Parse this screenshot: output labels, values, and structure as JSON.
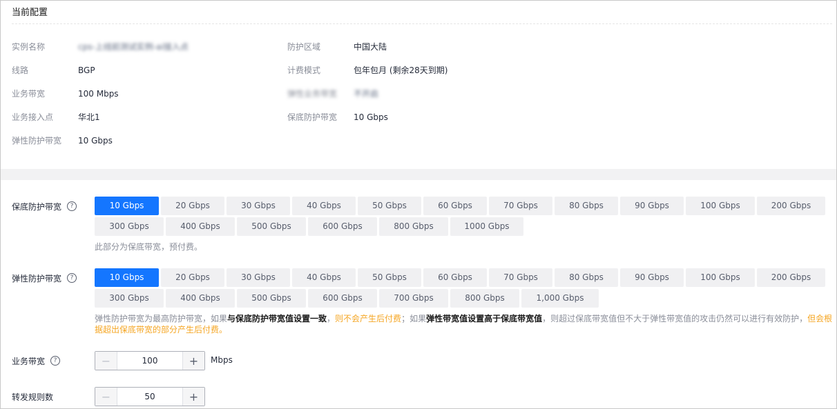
{
  "config": {
    "title": "当前配置",
    "items": [
      {
        "label": "实例名称",
        "value": "cps-上线前测试实例-ai接入点"
      },
      {
        "label": "线路",
        "value": "BGP"
      },
      {
        "label": "业务带宽",
        "value": "100 Mbps"
      },
      {
        "label": "业务接入点",
        "value": "华北1"
      },
      {
        "label": "弹性防护带宽",
        "value": "10 Gbps"
      },
      {
        "label": "防护区域",
        "value": "中国大陆"
      },
      {
        "label": "计费模式",
        "value": "包年包月 (剩余28天到期)"
      },
      {
        "label": "弹性业务带宽",
        "value": "不开启"
      },
      {
        "label": "保底防护带宽",
        "value": "10 Gbps"
      }
    ]
  },
  "base_protection": {
    "label": "保底防护带宽",
    "selected": "10 Gbps",
    "options_row1": [
      "10 Gbps",
      "20 Gbps",
      "30 Gbps",
      "40 Gbps",
      "50 Gbps",
      "60 Gbps",
      "70 Gbps",
      "80 Gbps",
      "90 Gbps",
      "100 Gbps",
      "200 Gbps"
    ],
    "options_row2": [
      "300 Gbps",
      "400 Gbps",
      "500 Gbps",
      "600 Gbps",
      "800 Gbps",
      "1000 Gbps"
    ],
    "hint": "此部分为保底带宽，预付费。"
  },
  "elastic_protection": {
    "label": "弹性防护带宽",
    "selected": "10 Gbps",
    "options_row1": [
      "10 Gbps",
      "20 Gbps",
      "30 Gbps",
      "40 Gbps",
      "50 Gbps",
      "60 Gbps",
      "70 Gbps",
      "80 Gbps",
      "90 Gbps",
      "100 Gbps",
      "200 Gbps"
    ],
    "options_row2": [
      "300 Gbps",
      "400 Gbps",
      "500 Gbps",
      "600 Gbps",
      "700 Gbps",
      "800 Gbps",
      "1,000 Gbps"
    ],
    "hint": {
      "p1": "弹性防护带宽为最高防护带宽，如果",
      "b1": "与保底防护带宽值设置一致",
      "p2": "，",
      "o1": "则不会产生后付费",
      "p3": "；如果",
      "b2": "弹性带宽值设置高于保底带宽值",
      "p4": "，则超过保底带宽值但不大于弹性带宽值的攻击仍然可以进行有效防护，",
      "o2": "但会根据超出保底带宽的部分产生后付费。"
    }
  },
  "business_bandwidth": {
    "label": "业务带宽",
    "value": "100",
    "unit": "Mbps"
  },
  "forward_rules": {
    "label": "转发规则数",
    "value": "50"
  },
  "icons": {
    "help": "?",
    "minus": "−",
    "plus": "+"
  }
}
